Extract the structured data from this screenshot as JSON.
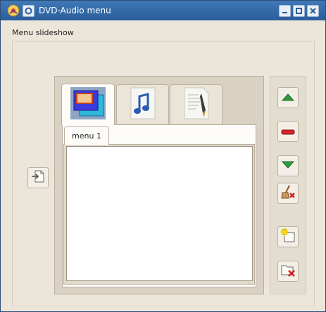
{
  "window": {
    "title": "DVD-Audio menu",
    "icons": {
      "app": "dvd-audio-app-icon",
      "menu": "window-menu-icon",
      "minimize": "minimize-icon",
      "maximize": "maximize-icon",
      "close": "close-icon"
    }
  },
  "section": {
    "label": "Menu slideshow"
  },
  "tabs": [
    {
      "icon": "slideshow-image-icon",
      "active": true
    },
    {
      "icon": "audio-file-icon",
      "active": false
    },
    {
      "icon": "text-document-icon",
      "active": false
    }
  ],
  "menu_tab": {
    "label": "menu 1"
  },
  "left_button": {
    "icon": "add-document-icon"
  },
  "side_buttons": [
    {
      "name": "move-up",
      "icon": "arrow-up-icon"
    },
    {
      "name": "remove",
      "icon": "remove-icon"
    },
    {
      "name": "move-down",
      "icon": "arrow-down-icon"
    },
    {
      "name": "clear",
      "icon": "clear-broom-icon"
    },
    {
      "name": "new-menu",
      "icon": "new-item-icon"
    },
    {
      "name": "delete-menu",
      "icon": "delete-folder-icon"
    }
  ],
  "colors": {
    "titlebar": "#2f68a8",
    "window_bg": "#ece6da",
    "up_arrow": "#2f9a3a",
    "remove": "#d6262c",
    "delete_x": "#d22020"
  }
}
